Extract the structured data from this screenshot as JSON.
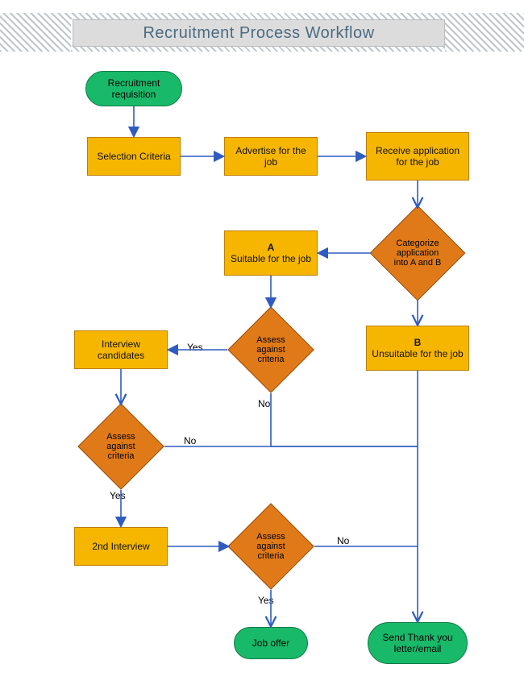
{
  "title": "Recruitment Process Workflow",
  "colors": {
    "process_fill": "#f6b600",
    "process_border": "#bd7f00",
    "decision_fill": "#e07a19",
    "decision_border": "#945010",
    "terminator_fill": "#19b96a",
    "terminator_border": "#117a45",
    "arrow": "#2f5cc0"
  },
  "nodes": {
    "recruitment_requisition": {
      "type": "terminator",
      "label": "Recruitment requisition"
    },
    "selection_criteria": {
      "type": "process",
      "label": "Selection Criteria"
    },
    "advertise": {
      "type": "process",
      "label": "Advertise for the job"
    },
    "receive_app": {
      "type": "process",
      "label": "Receive application for the job"
    },
    "categorize": {
      "type": "decision",
      "label": "Categorize application into A and B"
    },
    "a_suitable": {
      "type": "process",
      "label_head": "A",
      "label": "Suitable for the job"
    },
    "b_unsuitable": {
      "type": "process",
      "label_head": "B",
      "label": "Unsuitable for the job"
    },
    "assess1": {
      "type": "decision",
      "label": "Assess against criteria"
    },
    "interview_candidates": {
      "type": "process",
      "label": "Interview candidates"
    },
    "assess2": {
      "type": "decision",
      "label": "Assess against criteria"
    },
    "second_interview": {
      "type": "process",
      "label": "2nd Interview"
    },
    "assess3": {
      "type": "decision",
      "label": "Assess against criteria"
    },
    "job_offer": {
      "type": "terminator",
      "label": "Job offer"
    },
    "thank_you": {
      "type": "terminator",
      "label": "Send Thank you letter/email"
    }
  },
  "edges": [
    {
      "id": "e1",
      "from": "recruitment_requisition",
      "to": "selection_criteria"
    },
    {
      "id": "e2",
      "from": "selection_criteria",
      "to": "advertise"
    },
    {
      "id": "e3",
      "from": "advertise",
      "to": "receive_app"
    },
    {
      "id": "e4",
      "from": "receive_app",
      "to": "categorize"
    },
    {
      "id": "e5",
      "from": "categorize",
      "to": "a_suitable"
    },
    {
      "id": "e6",
      "from": "categorize",
      "to": "b_unsuitable"
    },
    {
      "id": "e7",
      "from": "a_suitable",
      "to": "assess1"
    },
    {
      "id": "e8",
      "from": "assess1",
      "to": "interview_candidates",
      "label": "Yes"
    },
    {
      "id": "e9",
      "from": "assess1",
      "to": "thank_you",
      "label": "No"
    },
    {
      "id": "e10",
      "from": "interview_candidates",
      "to": "assess2"
    },
    {
      "id": "e11",
      "from": "assess2",
      "to": "second_interview",
      "label": "Yes"
    },
    {
      "id": "e12",
      "from": "assess2",
      "to": "thank_you",
      "label": "No"
    },
    {
      "id": "e13",
      "from": "second_interview",
      "to": "assess3"
    },
    {
      "id": "e14",
      "from": "assess3",
      "to": "job_offer",
      "label": "Yes"
    },
    {
      "id": "e15",
      "from": "assess3",
      "to": "thank_you",
      "label": "No"
    },
    {
      "id": "e16",
      "from": "b_unsuitable",
      "to": "thank_you"
    }
  ],
  "edge_labels": {
    "yes": "Yes",
    "no": "No"
  }
}
